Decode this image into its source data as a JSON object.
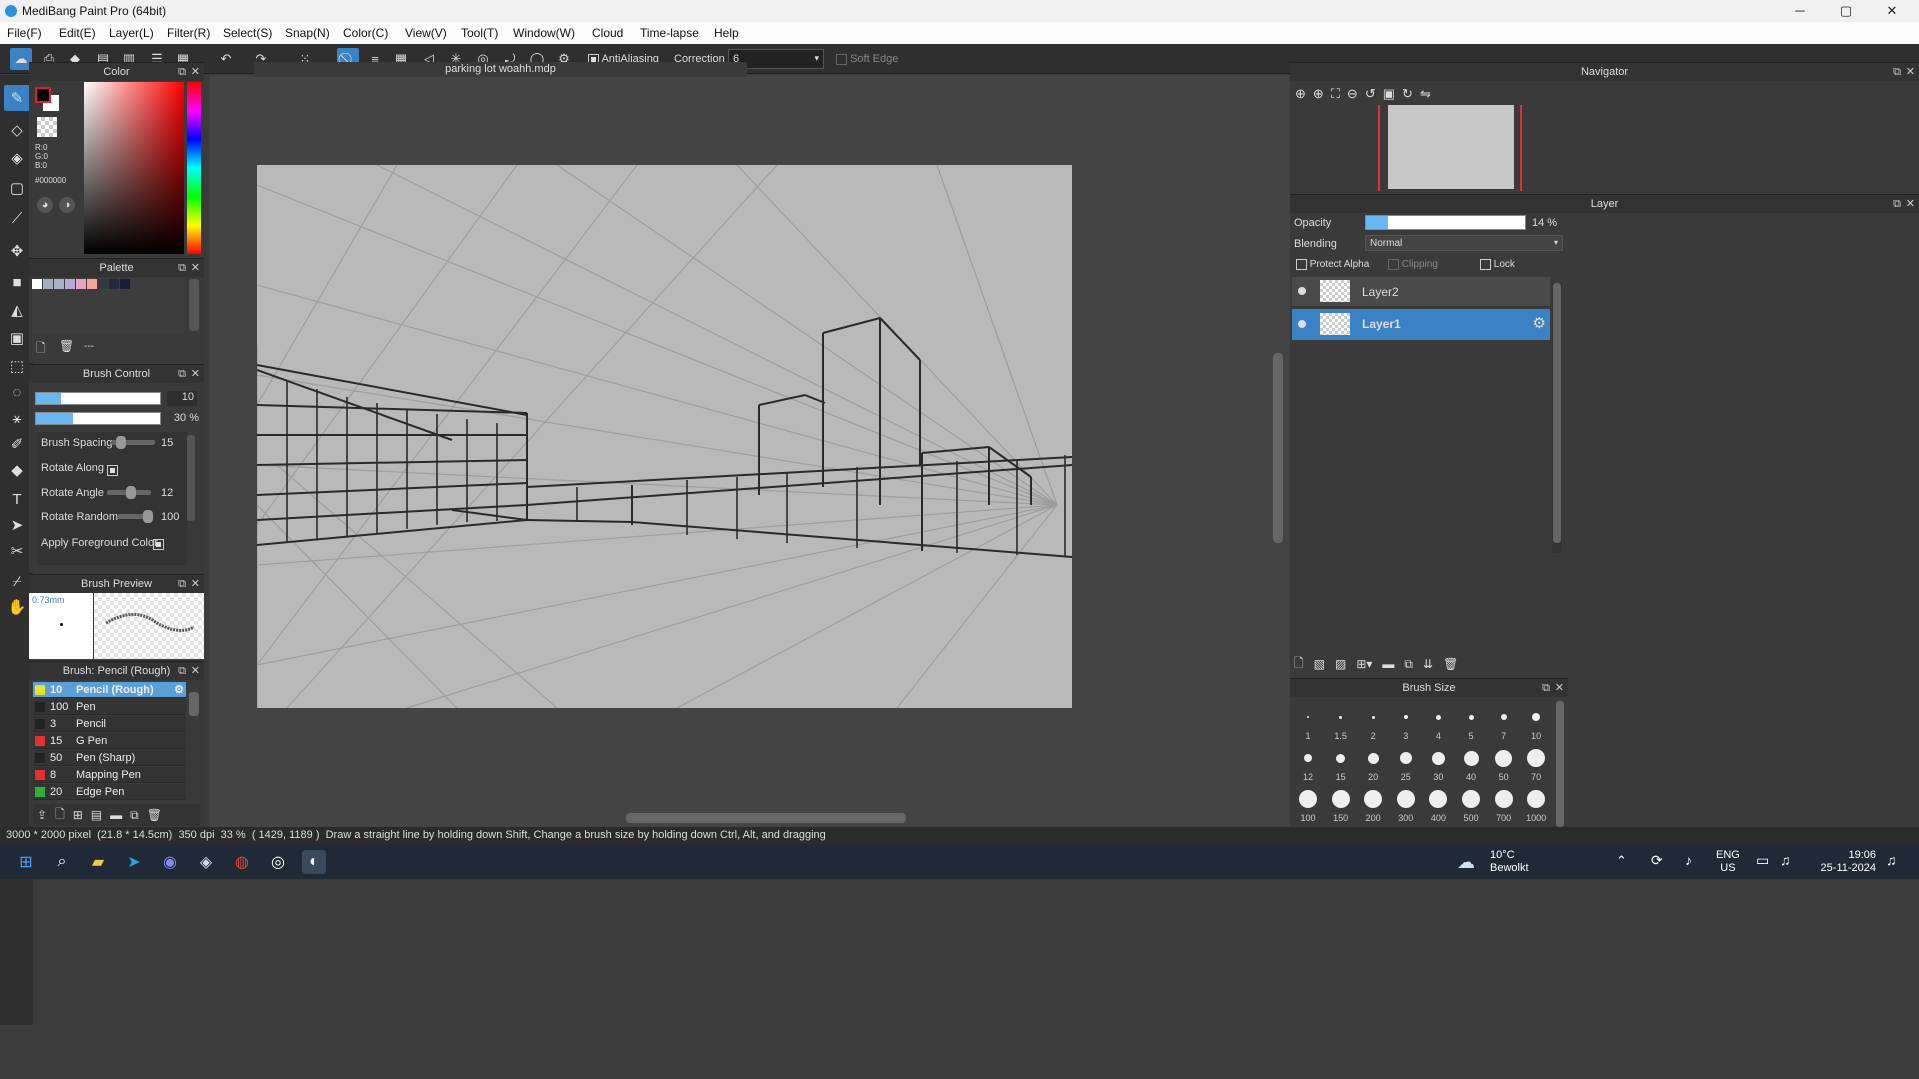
{
  "app": {
    "title": "MediBang Paint Pro (64bit)"
  },
  "window_controls": {
    "minimize": "─",
    "maximize": "▢",
    "close": "✕"
  },
  "menu": [
    "File(F)",
    "Edit(E)",
    "Layer(L)",
    "Filter(R)",
    "Select(S)",
    "Snap(N)",
    "Color(C)",
    "View(V)",
    "Tool(T)",
    "Window(W)",
    "Cloud",
    "Time-lapse",
    "Help"
  ],
  "toolbar": {
    "antialiasing_label": "AntiAliasing",
    "correction_label": "Correction",
    "correction_value": "6",
    "soft_edge_label": "Soft Edge"
  },
  "color_panel": {
    "title": "Color",
    "r": "R:0",
    "g": "G:0",
    "b": "B:0",
    "hex": "#000000"
  },
  "palette_panel": {
    "title": "Palette",
    "more": "---",
    "swatches": [
      "#ffffff",
      "#9fb0bd",
      "#a5b3c8",
      "#b6a8d8",
      "#e9a3c0",
      "#f7a3a0",
      "#333842",
      "#25283a",
      "#1a1d3a"
    ]
  },
  "brush_control": {
    "title": "Brush Control",
    "size_value": "10",
    "size_fill": 0.2,
    "opacity_value": "30 %",
    "opacity_fill": 0.3,
    "spacing_label": "Brush Spacing",
    "spacing_value": "15",
    "spacing_pos": 0.15,
    "rotate_along_label": "Rotate Along",
    "rotate_angle_label": "Rotate Angle",
    "rotate_angle_value": "12",
    "rotate_angle_pos": 0.55,
    "rotate_random_label": "Rotate Random",
    "rotate_random_value": "100",
    "rotate_random_pos": 1.0,
    "apply_fg_label": "Apply Foreground Color"
  },
  "brush_preview": {
    "title": "Brush Preview",
    "size": "0.73mm"
  },
  "brush_list": {
    "title": "Brush: Pencil (Rough)",
    "items": [
      {
        "num": "10",
        "name": "Pencil (Rough)",
        "color": "#e6e22a",
        "selected": true
      },
      {
        "num": "100",
        "name": "Pen",
        "color": "#222222"
      },
      {
        "num": "3",
        "name": "Pencil",
        "color": "#222222"
      },
      {
        "num": "15",
        "name": "G Pen",
        "color": "#e03030"
      },
      {
        "num": "50",
        "name": "Pen (Sharp)",
        "color": "#222222"
      },
      {
        "num": "8",
        "name": "Mapping Pen",
        "color": "#e03030"
      },
      {
        "num": "20",
        "name": "Edge Pen",
        "color": "#2fae3a"
      }
    ]
  },
  "document": {
    "tab": "parking lot woahh.mdp"
  },
  "navigator": {
    "title": "Navigator"
  },
  "layer_panel": {
    "title": "Layer",
    "opacity_label": "Opacity",
    "opacity_value": "14 %",
    "opacity_fill": 0.14,
    "blending_label": "Blending",
    "blending_value": "Normal",
    "protect_alpha": "Protect Alpha",
    "clipping": "Clipping",
    "lock": "Lock",
    "layers": [
      {
        "name": "Layer2",
        "selected": false
      },
      {
        "name": "Layer1",
        "selected": true
      }
    ]
  },
  "brush_size": {
    "title": "Brush Size",
    "sizes": [
      "1",
      "1.5",
      "2",
      "3",
      "4",
      "5",
      "7",
      "10",
      "12",
      "15",
      "20",
      "25",
      "30",
      "40",
      "50",
      "70",
      "100",
      "150",
      "200",
      "300",
      "400",
      "500",
      "700",
      "1000"
    ]
  },
  "status": {
    "dimensions": "3000 * 2000 pixel  (21.8 * 14.5cm)  350 dpi  33 %  ( 1429, 1189 )  Draw a straight line by holding down Shift, Change a brush size by holding down Ctrl, Alt, and dragging"
  },
  "taskbar": {
    "weather_temp": "10°C",
    "weather_desc": "Bewolkt",
    "lang1": "ENG",
    "lang2": "US",
    "time": "19:06",
    "date": "25-11-2024"
  }
}
